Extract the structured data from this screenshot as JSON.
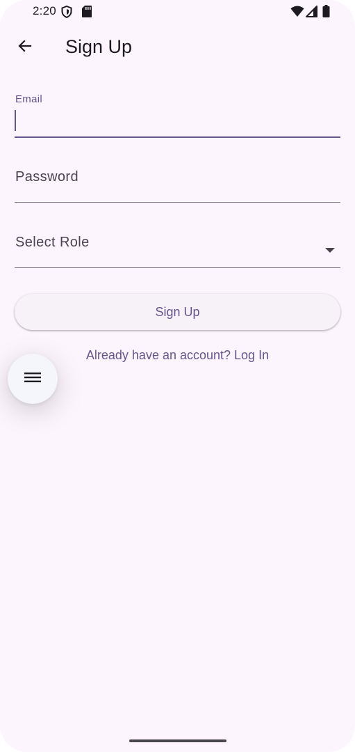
{
  "status_bar": {
    "time": "2:20",
    "icons": [
      "shield-icon",
      "sd-card-icon",
      "wifi-icon",
      "signal-icon",
      "battery-icon"
    ]
  },
  "app_bar": {
    "back_icon": "arrow-left-icon",
    "title": "Sign Up"
  },
  "form": {
    "email": {
      "label": "Email",
      "value": ""
    },
    "password": {
      "label": "Password",
      "value": ""
    },
    "role": {
      "label": "Select Role",
      "value": ""
    },
    "submit_label": "Sign Up",
    "login_link": "Already have an account? Log In"
  },
  "fab": {
    "icon": "menu-icon"
  },
  "colors": {
    "background": "#fcf5fd",
    "primary": "#65558f",
    "text": "#1d1b20",
    "label": "#49454f",
    "outline": "#79747e"
  }
}
